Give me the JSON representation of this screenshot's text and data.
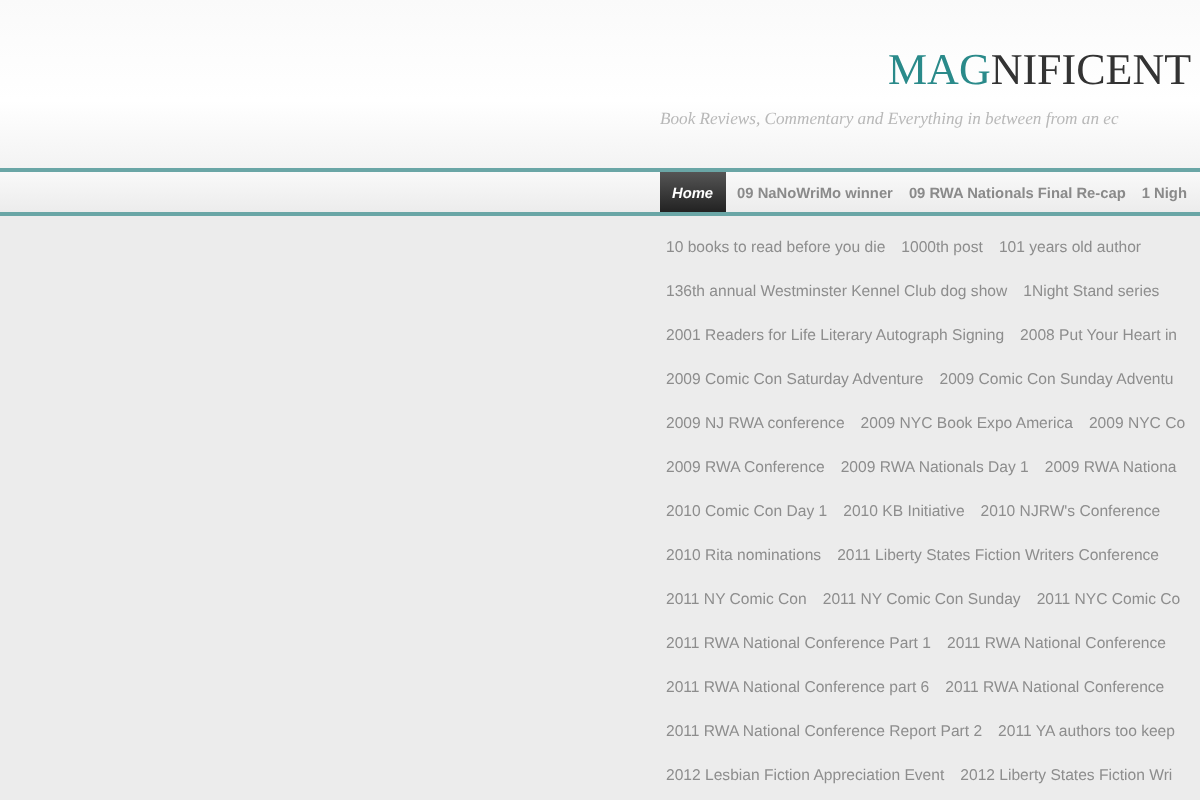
{
  "header": {
    "title_accent": "MAG",
    "title_rest": "NIFICENT",
    "tagline": "Book Reviews, Commentary and Everything in between from an ec"
  },
  "nav": {
    "items": [
      {
        "label": "Home",
        "selected": true
      },
      {
        "label": "09 NaNoWriMo winner",
        "selected": false
      },
      {
        "label": "09 RWA Nationals Final Re-cap",
        "selected": false
      },
      {
        "label": "1 Nigh",
        "selected": false
      }
    ]
  },
  "tag_rows": [
    [
      "10 books to read before you die",
      "1000th post",
      "101 years old author"
    ],
    [
      "136th annual Westminster Kennel Club dog show",
      "1Night Stand series"
    ],
    [
      "2001 Readers for Life Literary Autograph Signing",
      "2008 Put Your Heart in"
    ],
    [
      "2009 Comic Con Saturday Adventure",
      "2009 Comic Con Sunday Adventu"
    ],
    [
      "2009 NJ RWA conference",
      "2009 NYC Book Expo America",
      "2009 NYC Co"
    ],
    [
      "2009 RWA Conference",
      "2009 RWA Nationals Day 1",
      "2009 RWA Nationa"
    ],
    [
      "2010 Comic Con Day 1",
      "2010 KB Initiative",
      "2010 NJRW's Conference"
    ],
    [
      "2010 Rita nominations",
      "2011 Liberty States Fiction Writers Conference"
    ],
    [
      "2011 NY Comic Con",
      "2011 NY Comic Con Sunday",
      "2011 NYC Comic Co"
    ],
    [
      "2011 RWA National Conference Part 1",
      "2011 RWA National Conference"
    ],
    [
      "2011 RWA National Conference part 6",
      "2011 RWA National Conference"
    ],
    [
      "2011 RWA National Conference Report Part 2",
      "2011 YA authors too keep"
    ],
    [
      "2012 Lesbian Fiction Appreciation Event",
      "2012 Liberty States Fiction Wri"
    ]
  ]
}
